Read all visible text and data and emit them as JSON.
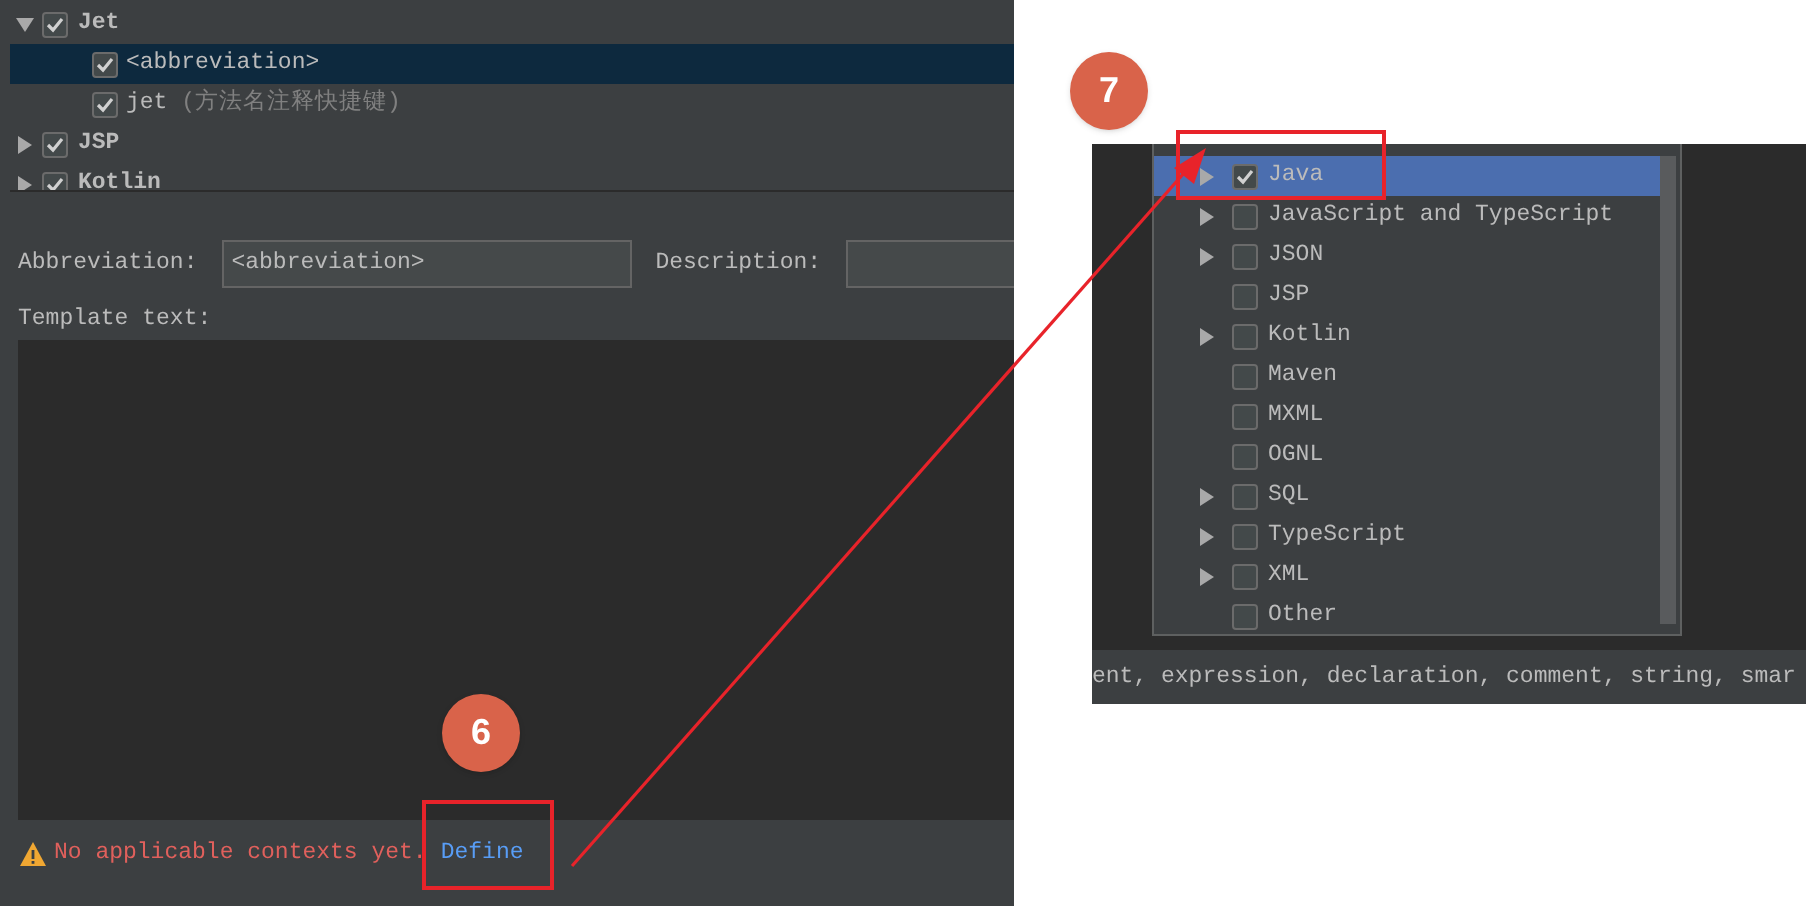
{
  "tree": [
    {
      "label": "Jet",
      "checked": true,
      "expanded": true,
      "selected": false,
      "children": [
        {
          "label": "<abbreviation>",
          "checked": true,
          "selected": true
        },
        {
          "label": "jet",
          "note": "(方法名注释快捷键)",
          "checked": true,
          "selected": false
        }
      ]
    },
    {
      "label": "JSP",
      "checked": true,
      "expanded": false,
      "selected": false
    },
    {
      "label": "Kotlin",
      "checked": true,
      "expanded": false,
      "selected": false
    }
  ],
  "form": {
    "abbreviation_label": "Abbreviation:",
    "abbreviation_value": "<abbreviation>",
    "description_label": "Description:",
    "template_label": "Template text:"
  },
  "warning": {
    "text": "No applicable contexts yet.",
    "link": "Define"
  },
  "context_popup": [
    {
      "label": "Java",
      "checked": true,
      "selected": true,
      "expandable": true
    },
    {
      "label": "JavaScript and TypeScript",
      "checked": false,
      "selected": false,
      "expandable": true
    },
    {
      "label": "JSON",
      "checked": false,
      "selected": false,
      "expandable": true
    },
    {
      "label": "JSP",
      "checked": false,
      "selected": false,
      "expandable": false
    },
    {
      "label": "Kotlin",
      "checked": false,
      "selected": false,
      "expandable": true
    },
    {
      "label": "Maven",
      "checked": false,
      "selected": false,
      "expandable": false
    },
    {
      "label": "MXML",
      "checked": false,
      "selected": false,
      "expandable": false
    },
    {
      "label": "OGNL",
      "checked": false,
      "selected": false,
      "expandable": false
    },
    {
      "label": "SQL",
      "checked": false,
      "selected": false,
      "expandable": true
    },
    {
      "label": "TypeScript",
      "checked": false,
      "selected": false,
      "expandable": true
    },
    {
      "label": "XML",
      "checked": false,
      "selected": false,
      "expandable": true
    },
    {
      "label": "Other",
      "checked": false,
      "selected": false,
      "expandable": false
    }
  ],
  "contexts_strip": "ent, expression, declaration, comment, string, smar",
  "callouts": [
    {
      "number": "6"
    },
    {
      "number": "7"
    }
  ]
}
